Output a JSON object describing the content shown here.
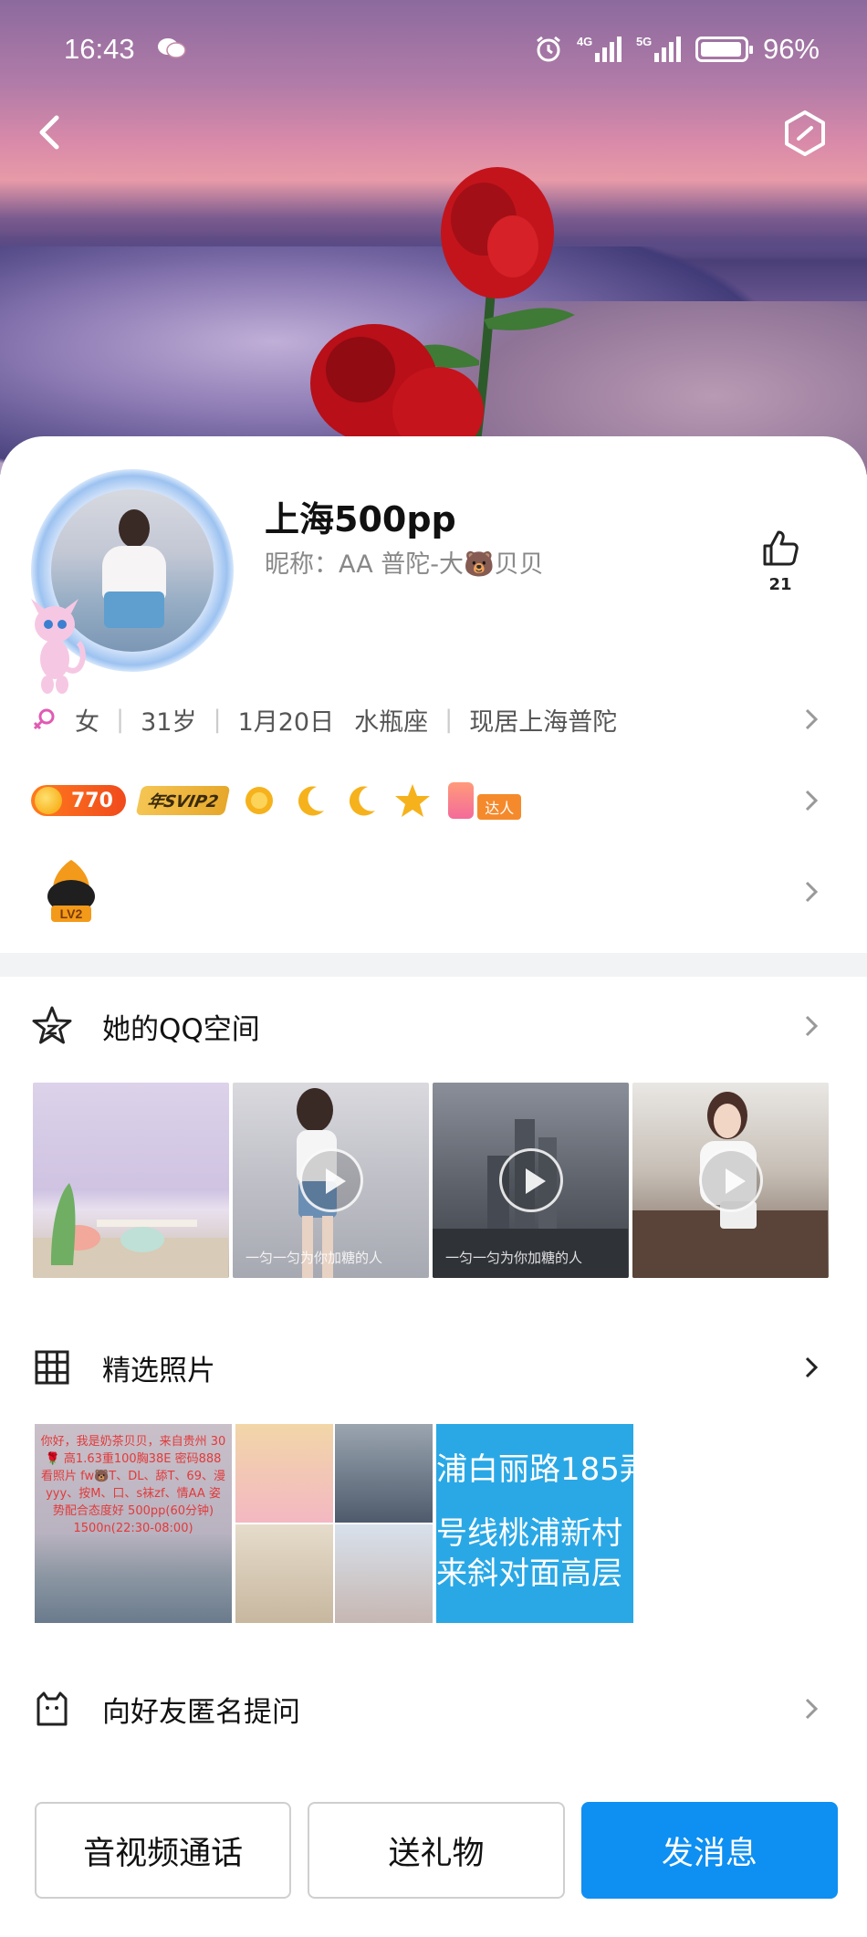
{
  "status_bar": {
    "time": "16:43",
    "network_1": "4G",
    "network_2": "5G",
    "battery": "96%"
  },
  "profile": {
    "name": "上海500pp",
    "nickname": "昵称：AA 普陀-大🐻贝贝",
    "likes": "21",
    "gender": "女",
    "age": "31岁",
    "birthday": "1月20日",
    "zodiac": "水瓶座",
    "location": "现居上海普陀",
    "coin_value": "770",
    "svip_label": "年SVIP2",
    "daren_label": "达人",
    "level_label": "LV2"
  },
  "qzone": {
    "title": "她的QQ空间",
    "captions": [
      "",
      "一匀一匀为你加糖的人",
      "一匀一匀为你加糖的人",
      ""
    ]
  },
  "photos": {
    "title": "精选照片",
    "ph1_text": "你好，我是奶茶贝贝，来自贵州 30🌹 高1.63重100胸38E 密码888看照片 fw🐻T、DL、舔T、69、漫yyy、按M、口、s袜zf、情AA 姿势配合态度好 500pp(60分钟) 1500n(22:30-08:00)",
    "ph3_lines": [
      "浦白丽路185弄",
      "号线桃浦新村",
      "来斜对面高层"
    ]
  },
  "anon_question": {
    "title": "向好友匿名提问"
  },
  "actions": {
    "call": "音视频通话",
    "gift": "送礼物",
    "message": "发消息"
  },
  "colors": {
    "primary": "#0e8ff2",
    "coin_pill": "#f04a1c",
    "svip_gold": "#e6a82b",
    "muted_text": "#888888"
  },
  "icons": {
    "back": "chevron-left-icon",
    "settings": "hexagon-icon",
    "like": "thumb-up-icon",
    "qzone": "star-outline-icon",
    "photos": "grid-icon",
    "anon": "cat-box-icon"
  }
}
